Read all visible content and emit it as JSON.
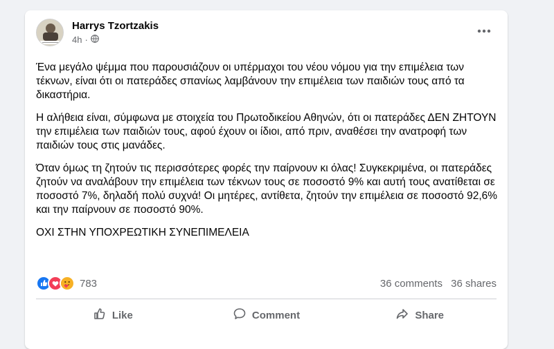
{
  "post": {
    "author": "Harrys Tzortzakis",
    "time": "4h",
    "paragraphs": [
      "Ένα μεγάλο ψέμμα που παρουσιάζουν οι υπέρμαχοι του νέου νόμου για την επιμέλεια των τέκνων, είναι ότι οι πατεράδες σπανίως λαμβάνουν την επιμέλεια των παιδιών τους από τα δικαστήρια.",
      "Η αλήθεια είναι, σύμφωνα με στοιχεία του Πρωτοδικείου Αθηνών, ότι οι πατεράδες ΔΕΝ ΖΗΤΟΥΝ την επιμέλεια των παιδιών τους, αφού έχουν οι ίδιοι, από πριν, αναθέσει την ανατροφή των παιδιών τους στις μανάδες.",
      "Όταν όμως τη ζητούν τις περισσότερες φορές την παίρνουν κι όλας! Συγκεκριμένα, οι πατεράδες ζητούν να αναλάβουν την επιμέλεια των τέκνων τους σε ποσοστό 9% και αυτή τους ανατίθεται σε ποσοστό 7%, δηλαδή πολύ συχνά! Οι μητέρες, αντίθετα, ζητούν την επιμέλεια σε ποσοστό 92,6% και την παίρνουν σε ποσοστό 90%.",
      "ΟΧΙ ΣΤΗΝ ΥΠΟΧΡΕΩΤΙΚΗ ΣΥΝΕΠΙΜΕΛΕΙΑ"
    ]
  },
  "stats": {
    "reactions_count": "783",
    "comments": "36 comments",
    "shares": "36 shares"
  },
  "actions": {
    "like": "Like",
    "comment": "Comment",
    "share": "Share"
  },
  "colors": {
    "like_blue": "#1877f2",
    "love_red": "#f33e58",
    "care_yellow": "#f7b125",
    "secondary_text": "#65676b"
  }
}
